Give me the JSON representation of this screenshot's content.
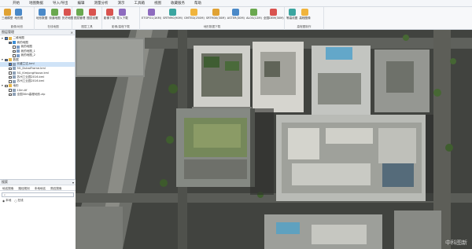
{
  "menu": [
    "开始",
    "地图数据",
    "导入/导出",
    "编辑",
    "测量分析",
    "演示",
    "工具箱",
    "视图",
    "收藏服务",
    "帮助"
  ],
  "ribbon": {
    "groups": [
      {
        "title": "影像/地形",
        "buttons": [
          "三维模型",
          "地形图"
        ]
      },
      {
        "title": "在线地图",
        "buttons": [
          "地形数据",
          "街道地图",
          "历史地图"
        ]
      },
      {
        "title": "图层工具",
        "buttons": [
          "图层管理",
          "图层设置"
        ]
      },
      {
        "title": "影像/高程下载",
        "buttons": [
          "影像下载",
          "导入下载"
        ]
      },
      {
        "title": "地形数据下载",
        "buttons": [
          "ETOPO1(1KM)",
          "SRTM90(90M)",
          "GMTED(250M)",
          "SRTM30(30M)",
          "ASTER(30M)",
          "ALOS(12M)",
          "全国DEM(30M)"
        ]
      },
      {
        "title": "高程图制作",
        "buttons": [
          "等高线图",
          "高程图像"
        ]
      }
    ]
  },
  "layers_panel": {
    "title": "图层管理",
    "items": [
      {
        "label": "二维地图",
        "level": 0,
        "type": "folder",
        "checked": true,
        "selected": false
      },
      {
        "label": "我的地图",
        "level": 1,
        "type": "globe",
        "checked": true,
        "selected": false
      },
      {
        "label": "我的地图",
        "level": 2,
        "type": "layer",
        "checked": false,
        "selected": false
      },
      {
        "label": "我的地图_1",
        "level": 2,
        "type": "layer",
        "checked": false,
        "selected": false
      },
      {
        "label": "我的地图_2",
        "level": 2,
        "type": "layer",
        "checked": false,
        "selected": false
      },
      {
        "label": "数据",
        "level": 0,
        "type": "folder",
        "checked": true,
        "selected": false
      },
      {
        "label": "长盛兰达.kml",
        "level": 1,
        "type": "file",
        "checked": true,
        "selected": true
      },
      {
        "label": "5G_DubaiFrame.kml",
        "level": 1,
        "type": "file",
        "checked": false,
        "selected": false
      },
      {
        "label": "5G_KimJongHouse.kml",
        "level": 1,
        "type": "file",
        "checked": false,
        "selected": false
      },
      {
        "label": "苏州工业园2016.kml",
        "level": 1,
        "type": "file",
        "checked": false,
        "selected": false
      },
      {
        "label": "苏州工业园2016.kml",
        "level": 1,
        "type": "file",
        "checked": false,
        "selected": false
      },
      {
        "label": "地形",
        "level": 0,
        "type": "folder",
        "checked": false,
        "selected": false
      },
      {
        "label": "10m.tif",
        "level": 1,
        "type": "file",
        "checked": false,
        "selected": false
      },
      {
        "label": "全国30m高程地形.zip",
        "level": 1,
        "type": "file",
        "checked": false,
        "selected": false
      }
    ]
  },
  "search_panel": {
    "title": "搜索",
    "tabs": [
      "地名搜索",
      "路径规划",
      "本地地名",
      "周边搜索"
    ],
    "placeholder": "",
    "options": [
      "本地",
      "在线"
    ]
  },
  "map": {
    "watermark": "中科图新"
  }
}
